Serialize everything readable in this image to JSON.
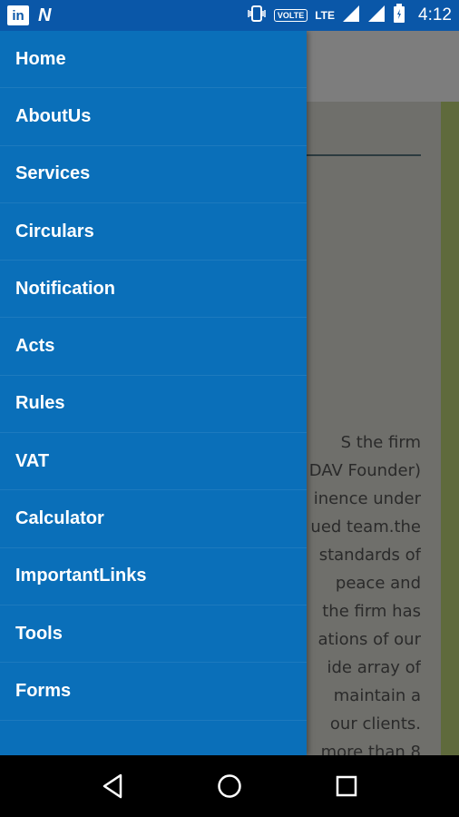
{
  "status_bar": {
    "left_icons": [
      "linkedin-icon",
      "n-notification-icon"
    ],
    "linkedin_text": "in",
    "n_text": "N",
    "volte": "VOLTE",
    "lte": "LTE",
    "time": "4:12"
  },
  "drawer": {
    "items": [
      {
        "label": "Home"
      },
      {
        "label": "AboutUs"
      },
      {
        "label": "Services"
      },
      {
        "label": "Circulars"
      },
      {
        "label": "Notification"
      },
      {
        "label": "Acts"
      },
      {
        "label": "Rules"
      },
      {
        "label": "VAT"
      },
      {
        "label": "Calculator"
      },
      {
        "label": "ImportantLinks"
      },
      {
        "label": "Tools"
      },
      {
        "label": "Forms"
      }
    ]
  },
  "background": {
    "lines": [
      "S  the  firm",
      "DAV Founder)",
      "inence under",
      "ued team.the",
      "standards  of",
      "peace   and",
      "the firm has",
      "ations of our",
      "ide  array  of",
      "maintain  a",
      "our  clients.",
      "more  than  8"
    ]
  },
  "nav_bar": {
    "icons": [
      "back-icon",
      "home-icon",
      "recents-icon"
    ]
  }
}
